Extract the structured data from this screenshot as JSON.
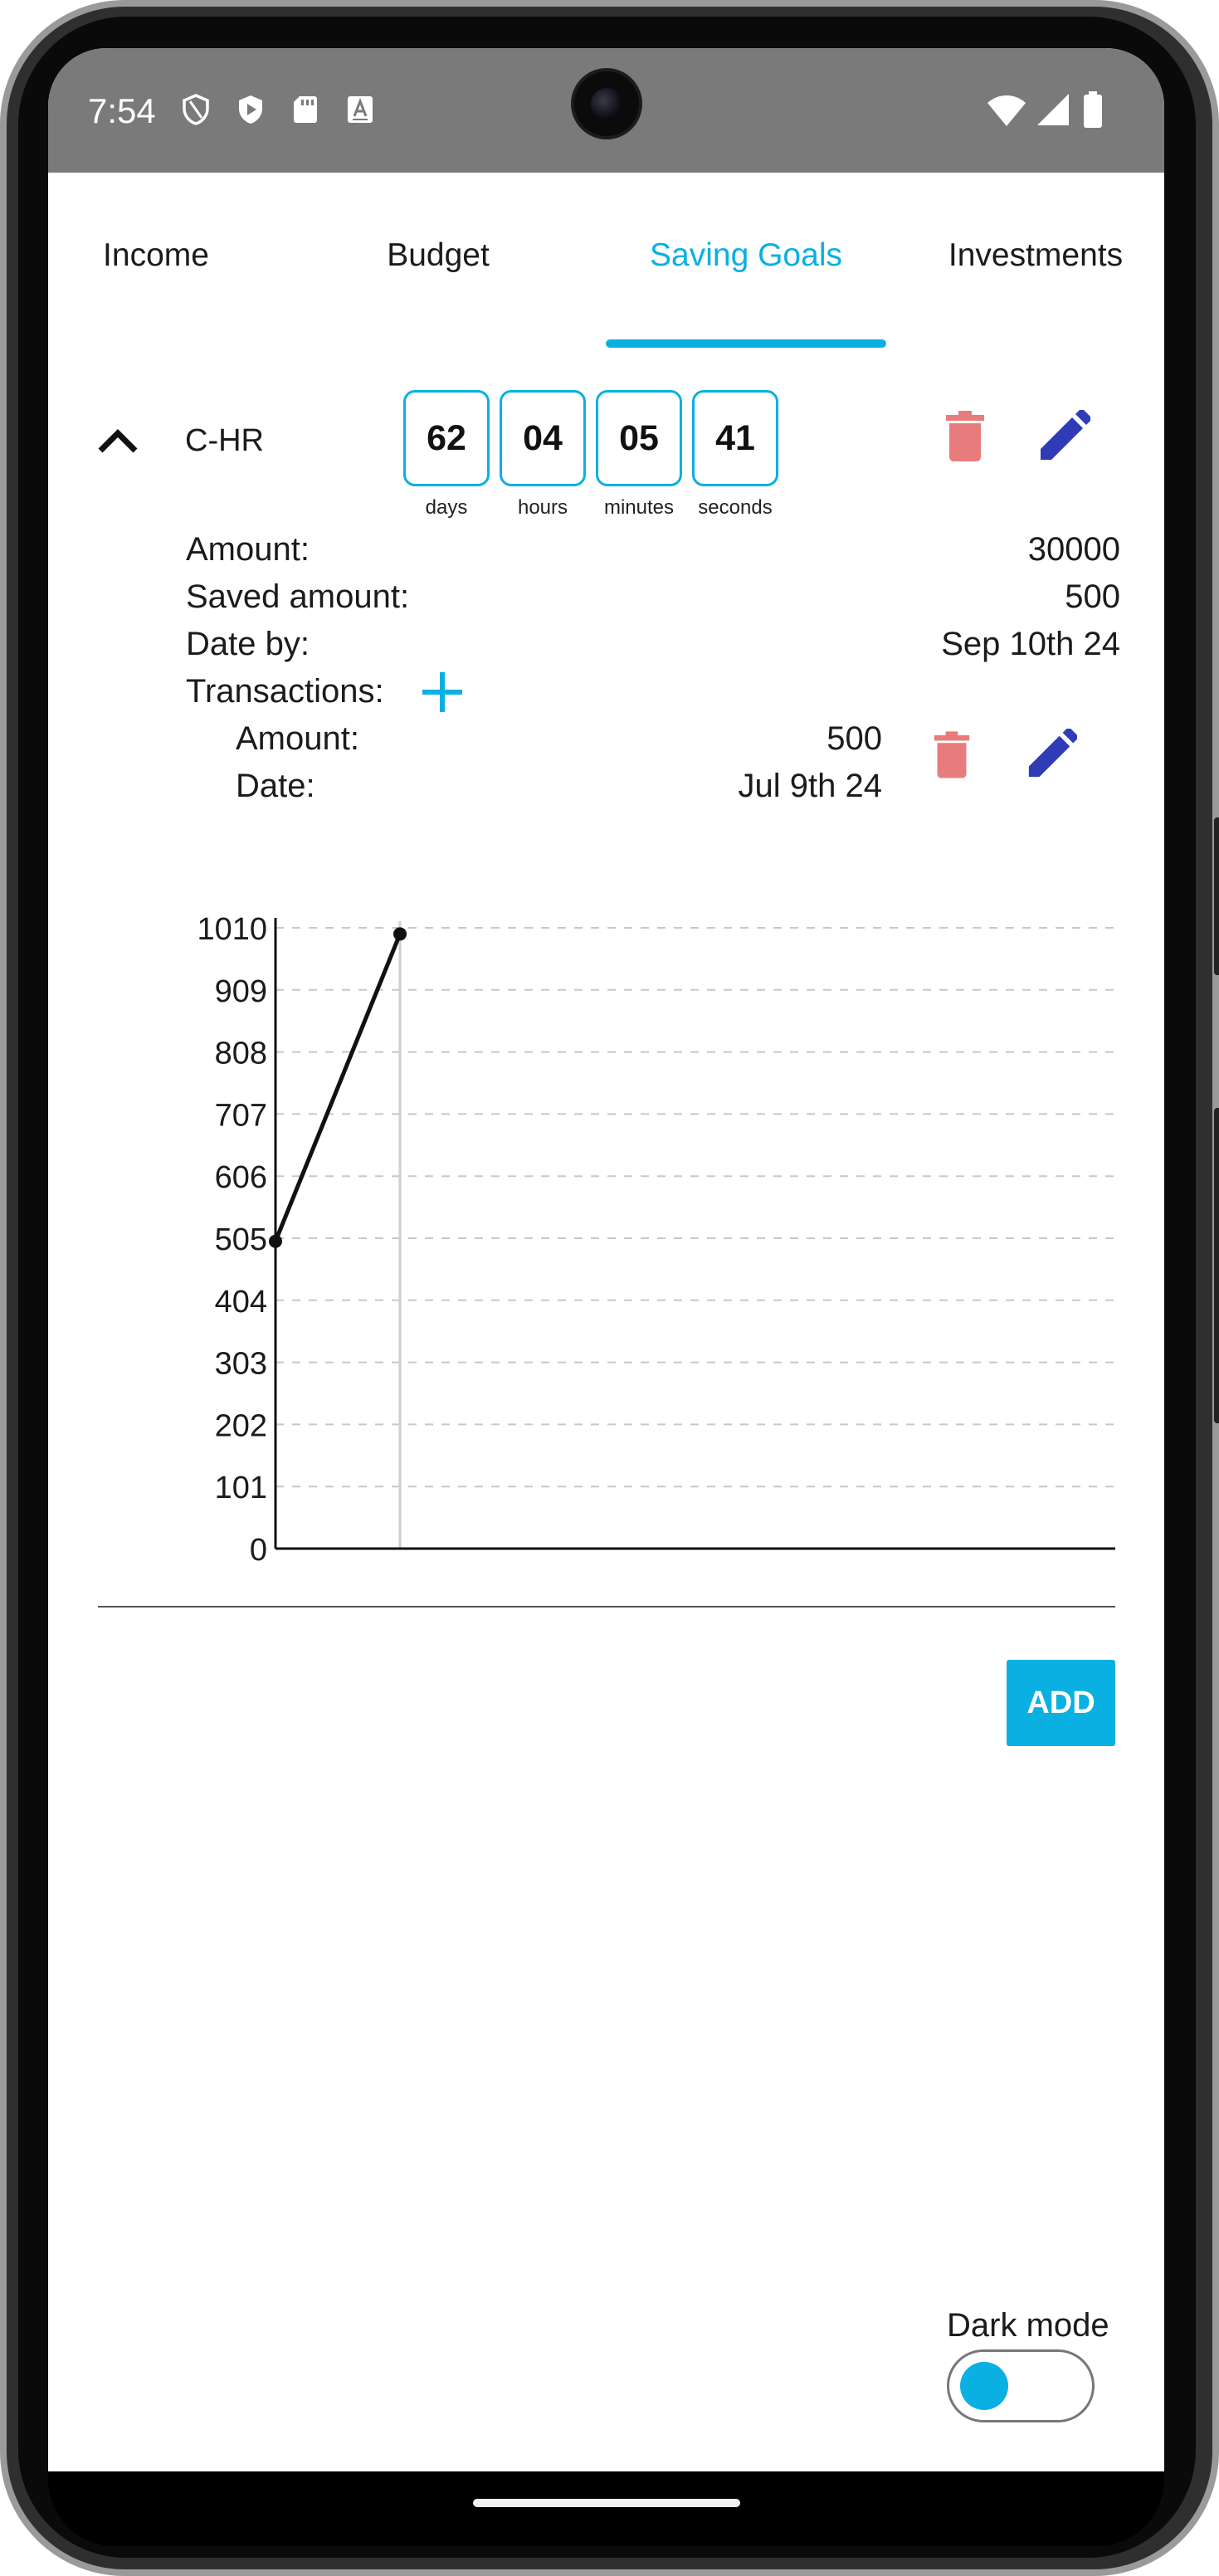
{
  "status_bar": {
    "time": "7:54",
    "icons": [
      "shield-outline-icon",
      "play-shield-icon",
      "sd-card-icon",
      "keyboard-a-icon",
      "wifi-icon",
      "signal-icon",
      "battery-icon"
    ]
  },
  "tabs": [
    {
      "label": "Income",
      "active": false
    },
    {
      "label": "Budget",
      "active": false
    },
    {
      "label": "Saving Goals",
      "active": true
    },
    {
      "label": "Investments",
      "active": false
    }
  ],
  "goal": {
    "name": "C-HR",
    "countdown": [
      {
        "value": "62",
        "unit": "days"
      },
      {
        "value": "04",
        "unit": "hours"
      },
      {
        "value": "05",
        "unit": "minutes"
      },
      {
        "value": "41",
        "unit": "seconds"
      }
    ],
    "details": {
      "amount_label": "Amount:",
      "amount_value": "30000",
      "saved_label": "Saved amount:",
      "saved_value": "500",
      "date_label": "Date by:",
      "date_value": "Sep 10th 24",
      "transactions_label": "Transactions:"
    },
    "transaction": {
      "amount_label": "Amount:",
      "amount_value": "500",
      "date_label": "Date:",
      "date_value": "Jul 9th 24"
    }
  },
  "chart_data": {
    "type": "line",
    "title": "",
    "xlabel": "",
    "ylabel": "",
    "ylim": [
      0,
      1010
    ],
    "yticks": [
      0,
      101,
      202,
      303,
      404,
      505,
      606,
      707,
      808,
      909,
      1010
    ],
    "grid": "horizontal dashed",
    "series": [
      {
        "values": [
          500,
          1000
        ]
      }
    ],
    "colors": {
      "line": "#111111",
      "grid": "#c8c8c8",
      "axis": "#111111"
    }
  },
  "actions": {
    "add_label": "ADD",
    "dark_mode_label": "Dark mode",
    "dark_mode_on": true
  },
  "colors": {
    "accent": "#0ab0e2",
    "delete": "#e87b7b",
    "edit": "#2e3cb8",
    "status_bar": "#7a7a7a"
  }
}
